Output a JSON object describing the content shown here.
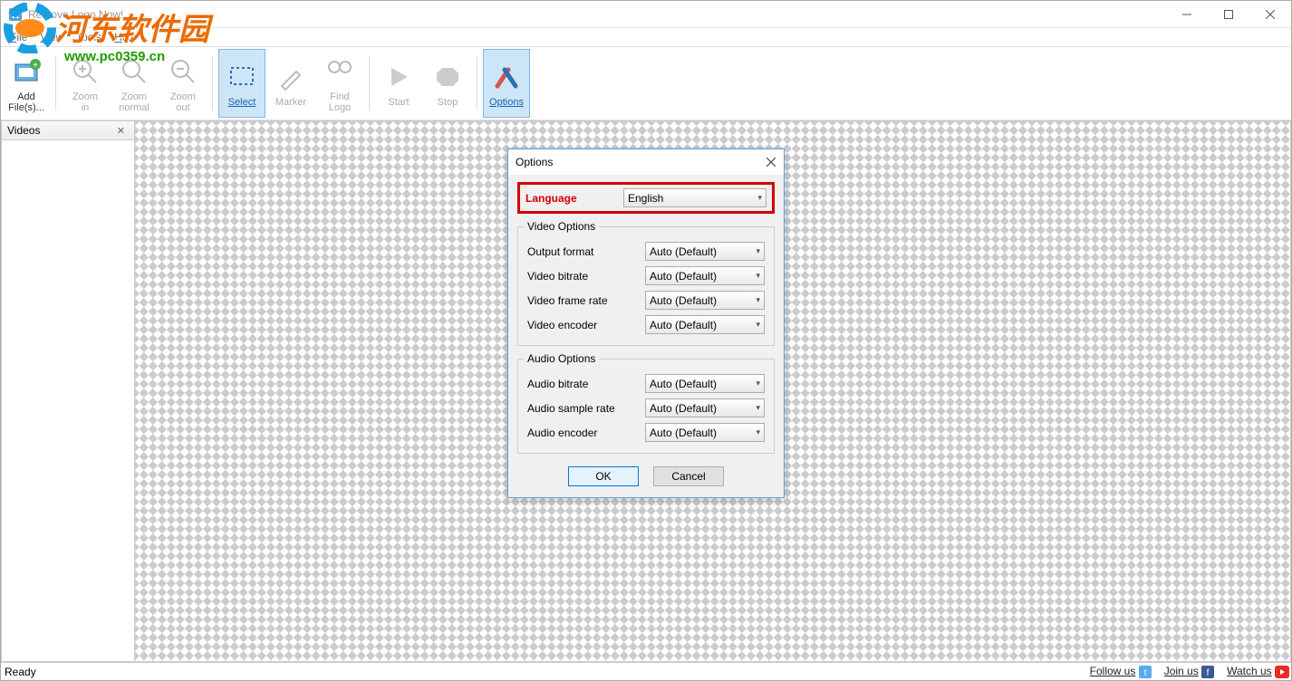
{
  "window": {
    "title": "Remove Logo Now!"
  },
  "menu": {
    "file": "File",
    "view": "View",
    "tools": "Tools",
    "help": "Help"
  },
  "toolbar": {
    "add": "Add\nFile(s)...",
    "zoom_in": "Zoom\nin",
    "zoom_normal": "Zoom\nnormal",
    "zoom_out": "Zoom\nout",
    "select": "Select",
    "marker": "Marker",
    "find_logo": "Find\nLogo",
    "start": "Start",
    "stop": "Stop",
    "options": "Options"
  },
  "sidebar": {
    "title": "Videos"
  },
  "status": {
    "ready": "Ready",
    "follow": "Follow us",
    "join": "Join us",
    "watch": "Watch us"
  },
  "dialog": {
    "title": "Options",
    "language_label": "Language",
    "language_value": "English",
    "video_legend": "Video Options",
    "audio_legend": "Audio Options",
    "output_format": "Output format",
    "video_bitrate": "Video bitrate",
    "video_framerate": "Video frame rate",
    "video_encoder": "Video encoder",
    "audio_bitrate": "Audio bitrate",
    "audio_samplerate": "Audio sample rate",
    "audio_encoder": "Audio encoder",
    "auto_default": "Auto (Default)",
    "ok": "OK",
    "cancel": "Cancel"
  },
  "watermark": {
    "text": "河东软件园",
    "url": "www.pc0359.cn"
  }
}
